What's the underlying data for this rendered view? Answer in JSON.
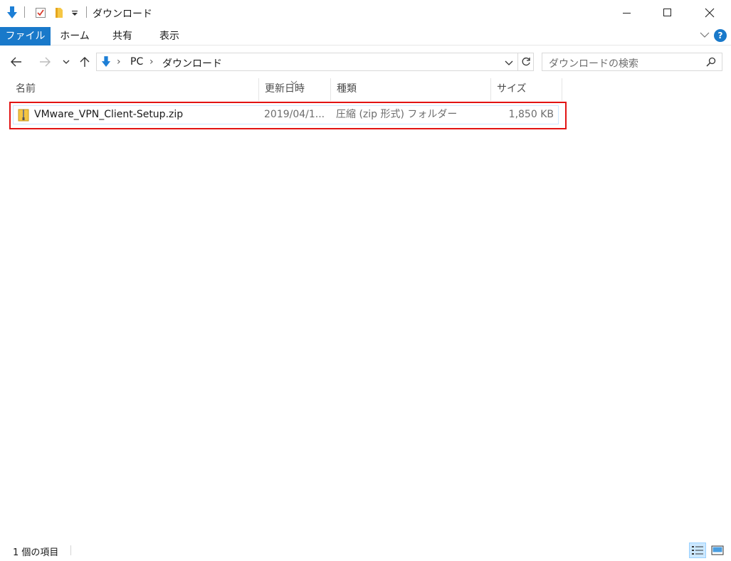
{
  "window": {
    "title": "ダウンロード",
    "minimize_icon": "minimize-icon",
    "maximize_icon": "maximize-icon",
    "close_icon": "close-icon"
  },
  "ribbon": {
    "tabs": [
      {
        "label": "ファイル",
        "active": true
      },
      {
        "label": "ホーム"
      },
      {
        "label": "共有"
      },
      {
        "label": "表示"
      }
    ],
    "help_label": "?"
  },
  "address_bar": {
    "breadcrumbs": [
      "PC",
      "ダウンロード"
    ]
  },
  "search": {
    "placeholder": "ダウンロードの検索"
  },
  "columns": {
    "name": "名前",
    "modified": "更新日時",
    "type": "種類",
    "size": "サイズ"
  },
  "files": [
    {
      "name": "VMware_VPN_Client-Setup.zip",
      "modified": "2019/04/1...",
      "type": "圧縮 (zip 形式) フォルダー",
      "size": "1,850 KB"
    }
  ],
  "status": {
    "item_count": "1 個の項目"
  },
  "colors": {
    "accent": "#1979ca",
    "highlight_border": "#e21313",
    "selection_border": "#cde8ff"
  }
}
